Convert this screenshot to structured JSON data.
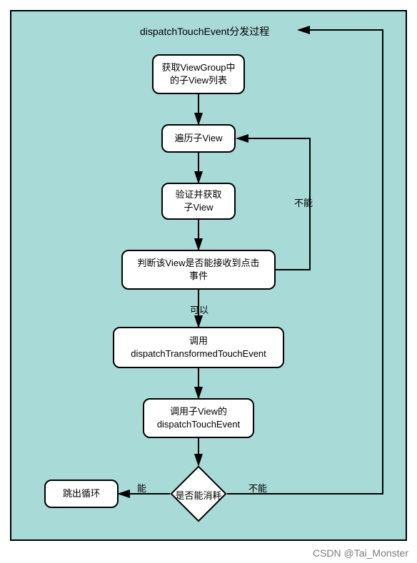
{
  "diagram": {
    "title": "dispatchTouchEvent分发过程",
    "nodes": {
      "n1": "获取ViewGroup中\n的子View列表",
      "n2": "遍历子View",
      "n3": "验证并获取\n子View",
      "n4": "判断该View是否能接收到点击\n事件",
      "n5": "调用\ndispatchTransformedTouchEvent",
      "n6": "调用子View的\ndispatchTouchEvent",
      "n7": "跳出循环",
      "d1": "是否能消耗"
    },
    "edges": {
      "e_n4_n5": "可以",
      "e_n4_n2": "不能",
      "e_d1_n7": "能",
      "e_d1_title": "不能"
    }
  },
  "watermark": "CSDN @Tai_Monster"
}
